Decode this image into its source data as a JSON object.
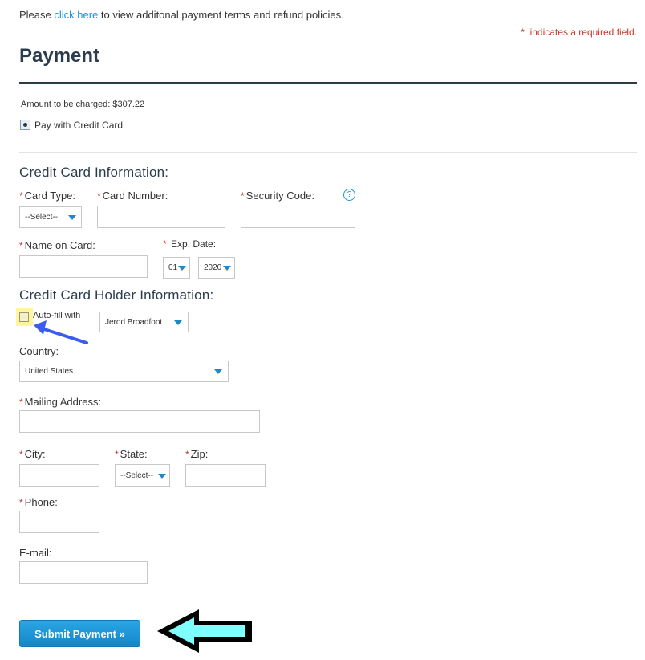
{
  "terms": {
    "prefix": "Please",
    "link": "click here",
    "suffix": "to view additonal payment terms and refund policies."
  },
  "required_note": {
    "star": "*",
    "text": "indicates a required field."
  },
  "page_title": "Payment",
  "amount_label": "Amount to be charged: $307.22",
  "pay_option_label": "Pay with Credit Card",
  "credit_card_section": {
    "title": "Credit Card Information:",
    "card_type_label": "Card Type:",
    "card_type_value": "--Select--",
    "card_number_label": "Card Number:",
    "security_code_label": "Security Code:",
    "help_icon": "?",
    "name_on_card_label": "Name on Card:",
    "exp_date_label": "Exp. Date:",
    "exp_month": "01",
    "exp_year": "2020"
  },
  "holder_section": {
    "title": "Credit Card Holder Information:",
    "autofill_label": "Auto-fill with",
    "autofill_value": "Jerod Broadfoot",
    "country_label": "Country:",
    "country_value": "United States",
    "mailing_label": "Mailing Address:",
    "city_label": "City:",
    "state_label": "State:",
    "state_value": "--Select--",
    "zip_label": "Zip:",
    "phone_label": "Phone:",
    "email_label": "E-mail:"
  },
  "required_star": "*",
  "submit_label": "Submit Payment »",
  "colors": {
    "accent": "#1a96d4",
    "required": "#c0392b",
    "annotation_arrow_blue": "#3c5cf0",
    "annotation_arrow_cyan": "#80ffff",
    "highlight": "#fff59d"
  }
}
